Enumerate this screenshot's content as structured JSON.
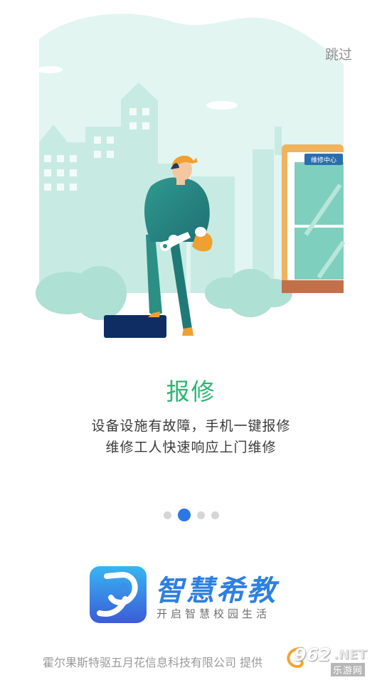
{
  "header": {
    "skip_label": "跳过"
  },
  "illustration": {
    "sign_text": "维修中心"
  },
  "slide": {
    "title": "报修",
    "description_line1": "设备设施有故障，手机一键报修",
    "description_line2": "维修工人快速响应上门维修"
  },
  "pager": {
    "total": 4,
    "active_index": 1
  },
  "brand": {
    "name": "智慧希教",
    "slogan": "开启智慧校园生活",
    "color": "#2e80e0"
  },
  "footer": {
    "provider_text": "霍尔果斯特驱五月花信息科技有限公司 提供"
  },
  "watermark": {
    "number": "962",
    "suffix": ".NET",
    "text": "乐游网"
  },
  "colors": {
    "title_green": "#2bb673",
    "active_dot": "#2a78e4",
    "inactive_dot": "#d6d6d6",
    "scene_bg": "#e2f5f1"
  }
}
